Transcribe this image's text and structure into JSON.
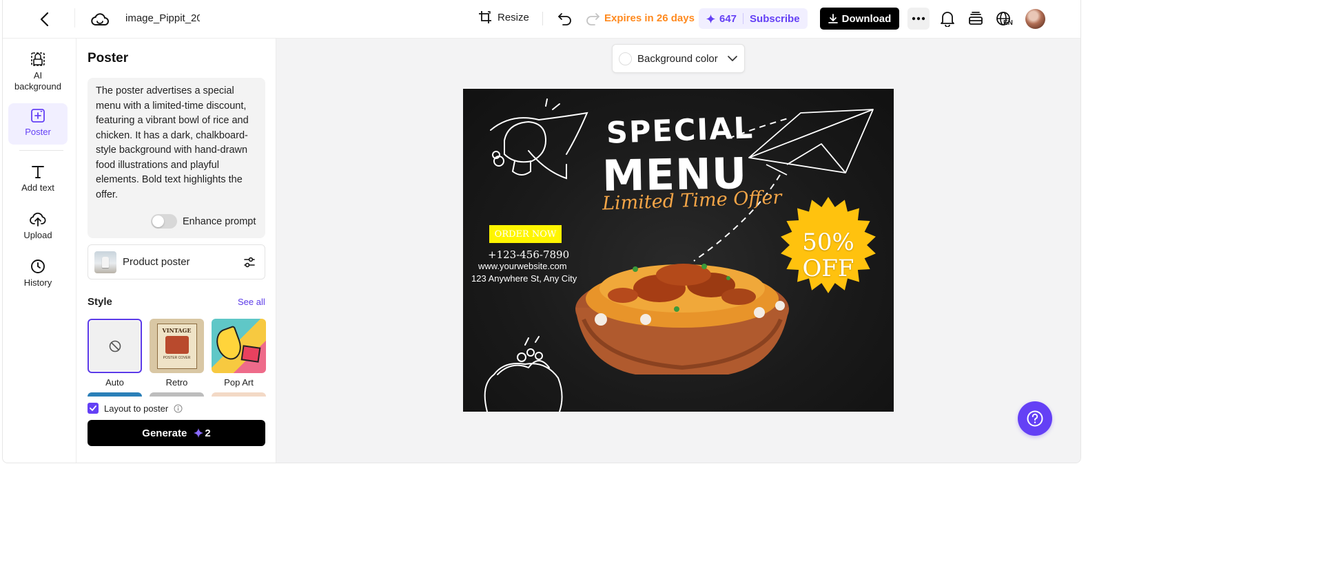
{
  "header": {
    "file_name": "image_Pippit_20",
    "resize_label": "Resize",
    "expires_label": "Expires in 26 days",
    "credits": "647",
    "subscribe_label": "Subscribe",
    "download_label": "Download",
    "language": "EN"
  },
  "rail": {
    "items": [
      {
        "label": "AI background"
      },
      {
        "label": "Poster"
      },
      {
        "label": "Add text"
      },
      {
        "label": "Upload"
      },
      {
        "label": "History"
      }
    ]
  },
  "panel": {
    "title": "Poster",
    "prompt": "The poster advertises a special menu with a limited-time discount, featuring a vibrant bowl of rice and chicken. It has a dark, chalkboard-style background with hand-drawn food illustrations and playful elements. Bold text highlights the offer.",
    "enhance_label": "Enhance prompt",
    "enhance_on": false,
    "product_label": "Product poster",
    "style_label": "Style",
    "see_all_label": "See all",
    "styles": [
      {
        "name": "Auto",
        "selected": true
      },
      {
        "name": "Retro",
        "selected": false
      },
      {
        "name": "Pop Art",
        "selected": false
      }
    ],
    "retro_thumb_text": [
      "VINTAGE",
      "POSTER COVER"
    ],
    "layout_label": "Layout to poster",
    "layout_checked": true,
    "generate_label": "Generate",
    "generate_cost": "2"
  },
  "canvas": {
    "bg_color_label": "Background color"
  },
  "poster": {
    "headline_1": "SPECIAL",
    "headline_2": "MENU",
    "tagline": "Limited Time Offer",
    "order_label": "ORDER NOW",
    "phone": "+123-456-7890",
    "website": "www.yourwebsite.com",
    "address": "123 Anywhere St, Any City",
    "badge_line_1": "50%",
    "badge_line_2": "OFF"
  },
  "colors": {
    "accent": "#6440f5",
    "expires": "#ff8a1f",
    "badge": "#ffc20e",
    "order_bg": "#fff500",
    "tagline": "#f4a547"
  }
}
